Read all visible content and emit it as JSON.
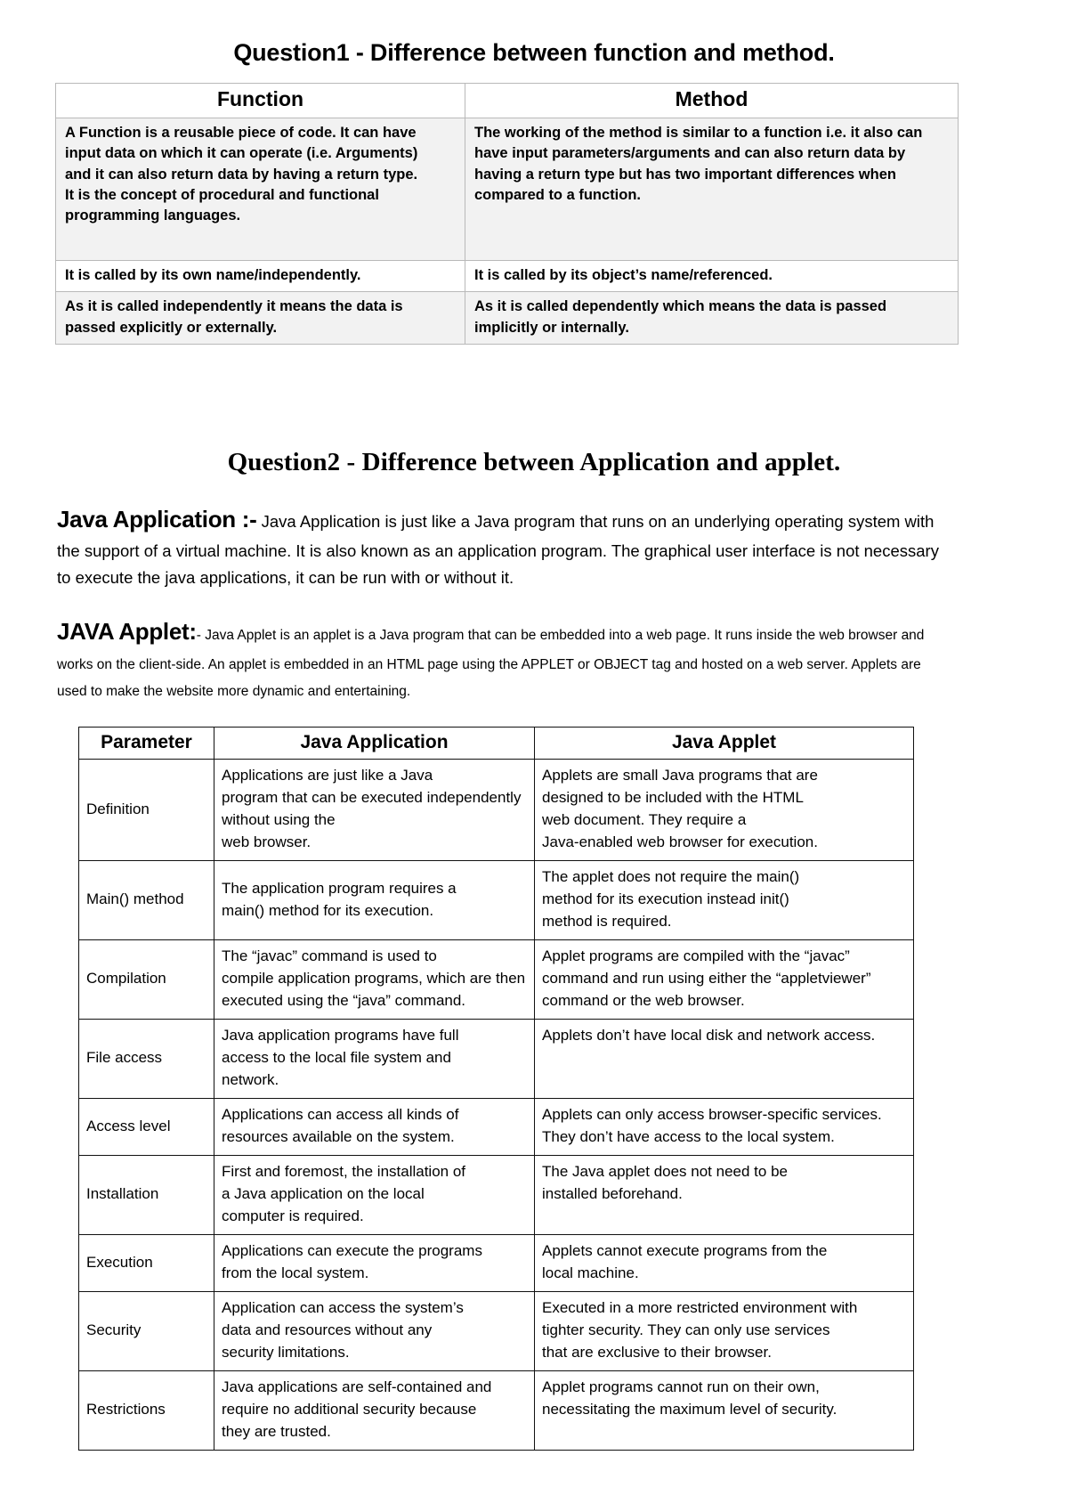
{
  "question1": {
    "title": "Question1 - Difference between function and method.",
    "table": {
      "headers": [
        "Function",
        "Method"
      ],
      "rows": [
        {
          "function_lines": [
            "A Function is a reusable piece of code. It can have",
            " input data on which it can operate (i.e. Arguments)",
            "and it can also return data by having a return type.",
            "It is the concept of procedural and functional",
            "programming languages."
          ],
          "method_lines": [
            "The working of the method is similar to a function i.e. it also can",
            "have input parameters/arguments and can also return data by",
            "having a return type but has two important differences when",
            "compared to a function."
          ]
        },
        {
          "function_lines": [
            "It is called by its own name/independently."
          ],
          "method_lines": [
            "It is called by its object’s name/referenced."
          ]
        },
        {
          "function_lines": [
            "As it is called independently it means the data is",
            "passed explicitly or externally."
          ],
          "method_lines": [
            "As it is called dependently which means the data is passed",
            "implicitly or internally."
          ]
        }
      ]
    }
  },
  "question2": {
    "title": "Question2 - Difference between Application and applet.",
    "application_paragraph": {
      "lead": "Java Application :-",
      "text": " Java Application is just like a Java program that runs on an underlying operating system with the support of a virtual machine. It is also known as an application program. The graphical user interface is not necessary to execute the java applications, it can be run with or without it."
    },
    "applet_paragraph": {
      "lead": "JAVA Applet:",
      "text": "- Java Applet is an applet is a Java program that can be embedded into a web page. It runs inside the web browser and works on the client-side. An applet is embedded in an HTML page using the APPLET or OBJECT tag and hosted on a web server. Applets are used to make the website more dynamic and entertaining."
    },
    "table": {
      "headers": [
        "Parameter",
        "Java Application",
        "Java Applet"
      ],
      "rows": [
        {
          "parameter": "Definition",
          "application_lines": [
            "Applications are just like a Java",
            "program that can be executed independently",
            "without using the",
            "web browser."
          ],
          "applet_lines": [
            "Applets are small Java programs that are",
            "designed to be included with the HTML",
            "web document. They require a",
            "Java-enabled web browser for execution."
          ]
        },
        {
          "parameter": "Main() method",
          "application_lines": [
            "The application program requires a",
            "main() method for its execution."
          ],
          "applet_lines": [
            "The applet does not require the main()",
            "method for its execution instead init()",
            "method is required."
          ]
        },
        {
          "parameter": "Compilation",
          "application_lines": [
            "The “javac” command is used to",
            "compile application programs, which are then",
            "executed using the “java” command."
          ],
          "applet_lines": [
            "Applet programs are compiled with the “javac”",
            "command and run using either the “appletviewer”",
            "command or the web browser."
          ]
        },
        {
          "parameter": "File access",
          "application_lines": [
            "Java application programs have full",
            "access to the local file system and",
            "network."
          ],
          "applet_lines": [
            "Applets don’t have local disk and network access."
          ]
        },
        {
          "parameter": "Access level",
          "application_lines": [
            "Applications can access all kinds of",
            "resources available on the system."
          ],
          "applet_lines": [
            "Applets can only access browser-specific services.",
            "They don’t have access to the local system."
          ]
        },
        {
          "parameter": "Installation",
          "application_lines": [
            "First and foremost, the installation of",
            "a Java application on the local",
            "computer is required."
          ],
          "applet_lines": [
            "The Java applet does not need to be",
            "installed beforehand."
          ]
        },
        {
          "parameter": "Execution",
          "application_lines": [
            "Applications can execute the programs",
            " from the local system."
          ],
          "applet_lines": [
            "Applets cannot execute programs from the",
            "local machine."
          ]
        },
        {
          "parameter": "Security",
          "application_lines": [
            "Application can access the system’s",
            "data and resources without any",
            "security limitations."
          ],
          "applet_lines": [
            "Executed in a more restricted environment with",
            " tighter security. They can only use services",
            " that are exclusive to their browser."
          ]
        },
        {
          "parameter": "Restrictions",
          "application_lines": [
            "Java applications are self-contained and",
            " require no additional security because",
            " they are trusted."
          ],
          "applet_lines": [
            "Applet programs cannot run on their own,",
            "necessitating the maximum level of security."
          ]
        }
      ]
    }
  }
}
